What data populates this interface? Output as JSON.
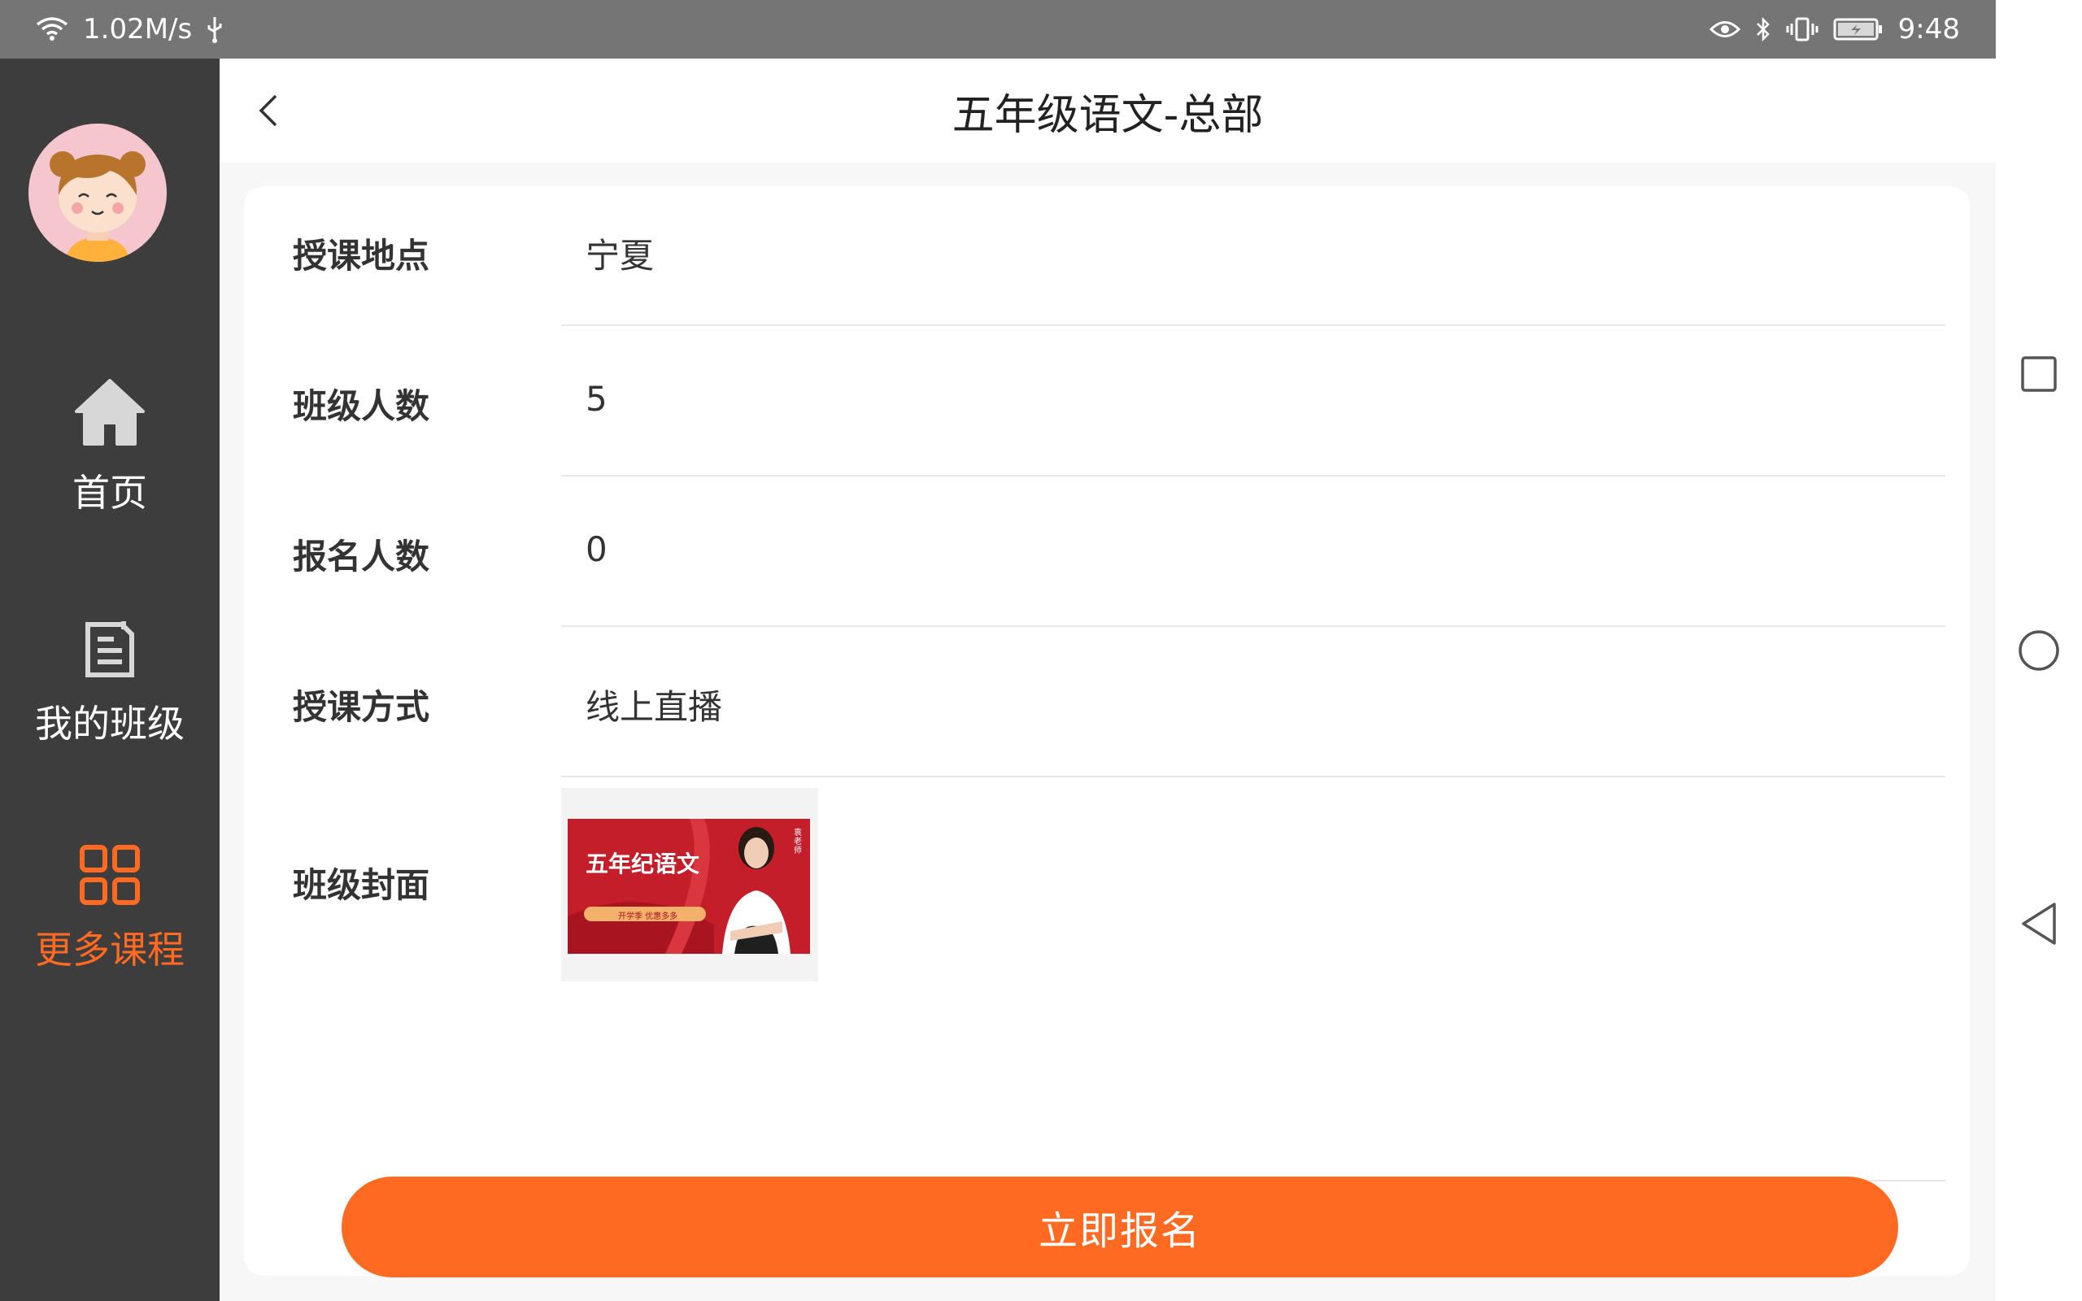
{
  "status_bar": {
    "network_speed": "1.02M/s",
    "time": "9:48"
  },
  "sidebar": {
    "items": [
      {
        "label": "首页",
        "icon": "home-icon",
        "active": false
      },
      {
        "label": "我的班级",
        "icon": "class-icon",
        "active": false
      },
      {
        "label": "更多课程",
        "icon": "grid-icon",
        "active": true
      }
    ]
  },
  "header": {
    "title": "五年级语文-总部"
  },
  "details": {
    "rows": [
      {
        "label": "授课地点",
        "value": "宁夏"
      },
      {
        "label": "班级人数",
        "value": "5"
      },
      {
        "label": "报名人数",
        "value": "0"
      },
      {
        "label": "授课方式",
        "value": "线上直播"
      },
      {
        "label": "班级封面",
        "value": ""
      }
    ]
  },
  "cover": {
    "title_text": "五年纪语文",
    "sub_text": "开学季 优惠多多",
    "teacher_text": "袁老师"
  },
  "actions": {
    "signup_label": "立即报名"
  },
  "colors": {
    "accent": "#ff6a22",
    "sidebar_bg": "#3d3d3d",
    "status_bar_bg": "#757575"
  }
}
